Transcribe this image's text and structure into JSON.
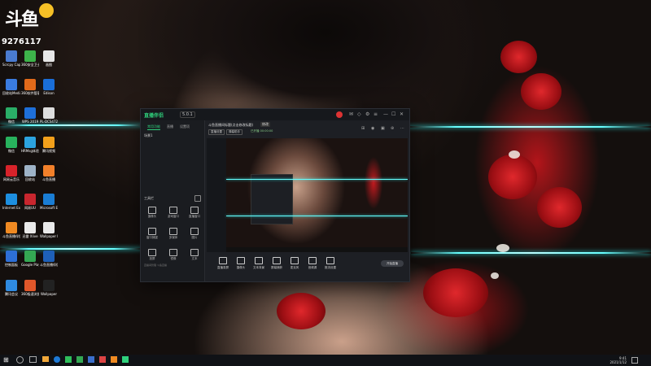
{
  "desktop": {
    "logo_text": "斗鱼",
    "room_number": "9276117",
    "icons": [
      {
        "label": "Scrcpy Capabilities",
        "color": "#4a7bd0"
      },
      {
        "label": "360安全卫士",
        "color": "#3db34a"
      },
      {
        "label": "画图",
        "color": "#e7e7e7"
      },
      {
        "label": "回收站Media+Lib",
        "color": "#3a7be0"
      },
      {
        "label": "360软件管家",
        "color": "#e26a1a"
      },
      {
        "label": "Edison",
        "color": "#1a6ed8"
      },
      {
        "label": "微信",
        "color": "#2aae67"
      },
      {
        "label": "WPS 2019",
        "color": "#1e6fd9"
      },
      {
        "label": "PL-DCS472026",
        "color": "#ddd"
      },
      {
        "label": "微信",
        "color": "#28b25d"
      },
      {
        "label": "HRMsg体验版",
        "color": "#2ca3df"
      },
      {
        "label": "腾讯视频",
        "color": "#f2a01b"
      },
      {
        "label": "网易云音乐",
        "color": "#d8232a"
      },
      {
        "label": "回收站",
        "color": "#9eb3c7"
      },
      {
        "label": "斗鱼直播",
        "color": "#f2802a"
      },
      {
        "label": "Internet Explorer",
        "color": "#1d8fe0"
      },
      {
        "label": "网易UU",
        "color": "#c8262e"
      },
      {
        "label": "Microsoft Edge",
        "color": "#1a7dd4"
      },
      {
        "label": "斗鱼直播伴侣",
        "color": "#f08a22"
      },
      {
        "label": "迅雷 Xlive",
        "color": "#e9e9e9"
      },
      {
        "label": "Wallpaper Engine",
        "color": "#e9e9e9"
      },
      {
        "label": "控制面板",
        "color": "#2d6fd6"
      },
      {
        "label": "Google Play",
        "color": "#34a853"
      },
      {
        "label": "斗鱼直播伴侣",
        "color": "#1e60b8"
      },
      {
        "label": "腾讯会议",
        "color": "#2f8ae0"
      },
      {
        "label": "360极速浏览器",
        "color": "#e0572a"
      },
      {
        "label": "Wallpaper",
        "color": "#222"
      }
    ]
  },
  "app": {
    "name": "直播伴侣",
    "version": "5.0.1",
    "tabs": [
      "常用功能",
      "直播",
      "设置项"
    ],
    "side_labels": {
      "scene": "场景1",
      "tools": "工具栏"
    },
    "tools": [
      "摄像头",
      "游戏窗口",
      "直播窗口",
      "窗口捕捉",
      "多媒体",
      "图片",
      "投屏",
      "镜像",
      "文本"
    ],
    "room_title": "斗鱼直播间标题(点击修改标题)",
    "room_edit": "修改",
    "chips": [
      "直播设置",
      "弹幕助手"
    ],
    "room_status": "已开播 00:00:00",
    "bottom_tools": [
      "直播录屏",
      "摄像头",
      "文本背景",
      "屏幕捕获",
      "麦克风",
      "音频源",
      "推流设置"
    ],
    "start_label": "开始直播",
    "footer": "直播间管理 斗鱼直播"
  },
  "taskbar": {
    "time": "9:41",
    "date": "2021/1/12"
  },
  "colors": {
    "accent_green": "#2fd17c",
    "glow_cyan": "#66ffff"
  }
}
